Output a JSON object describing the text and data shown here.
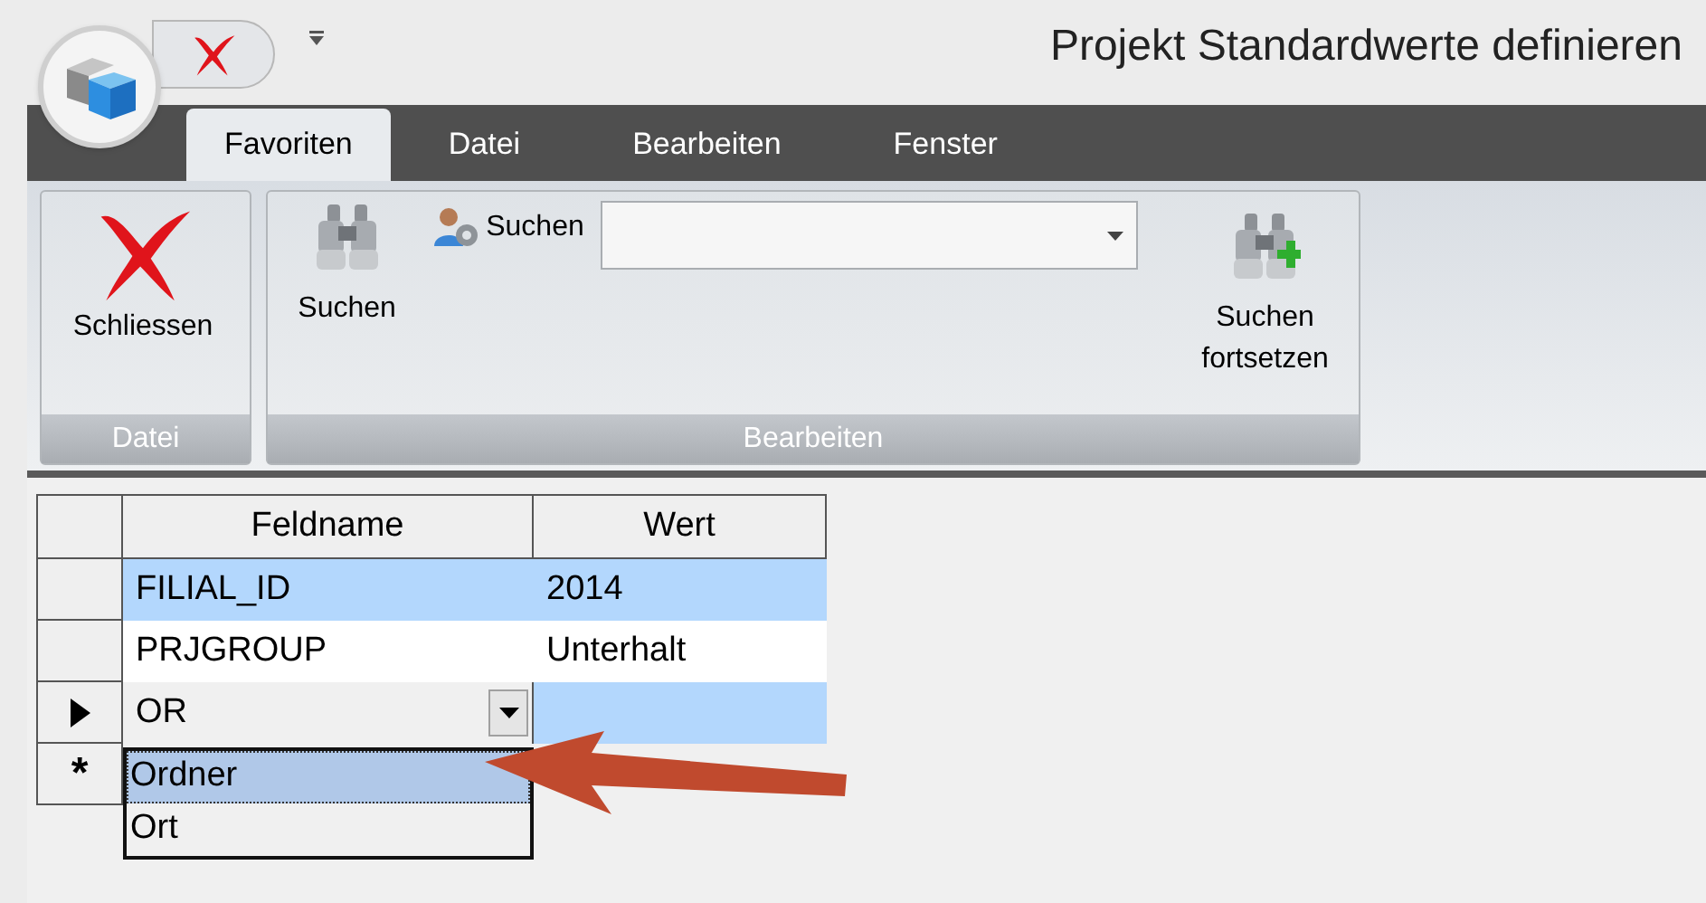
{
  "window": {
    "title": "Projekt Standardwerte definieren"
  },
  "tabs": [
    {
      "label": "Favoriten",
      "selected": true
    },
    {
      "label": "Datei",
      "selected": false
    },
    {
      "label": "Bearbeiten",
      "selected": false
    },
    {
      "label": "Fenster",
      "selected": false
    }
  ],
  "ribbon": {
    "groups": [
      {
        "label": "Datei",
        "items": [
          {
            "kind": "close",
            "label": "Schliessen"
          }
        ]
      },
      {
        "label": "Bearbeiten",
        "items": [
          {
            "kind": "search",
            "label": "Suchen"
          },
          {
            "kind": "search_combo",
            "label": "Suchen"
          },
          {
            "kind": "search_next",
            "label": "Suchen fortsetzen"
          }
        ]
      }
    ]
  },
  "grid": {
    "columns": [
      "Feldname",
      "Wert"
    ],
    "rows": [
      {
        "kind": "data",
        "highlighted": true,
        "cells": [
          "FILIAL_ID",
          "2014"
        ]
      },
      {
        "kind": "data",
        "highlighted": false,
        "cells": [
          "PRJGROUP",
          "Unterhalt"
        ]
      },
      {
        "kind": "editing",
        "highlighted": true,
        "cells": [
          "OR",
          ""
        ]
      },
      {
        "kind": "new",
        "marker": "*"
      }
    ],
    "dropdown": [
      {
        "label": "Ordner",
        "selected": true
      },
      {
        "label": "Ort",
        "selected": false
      }
    ]
  }
}
